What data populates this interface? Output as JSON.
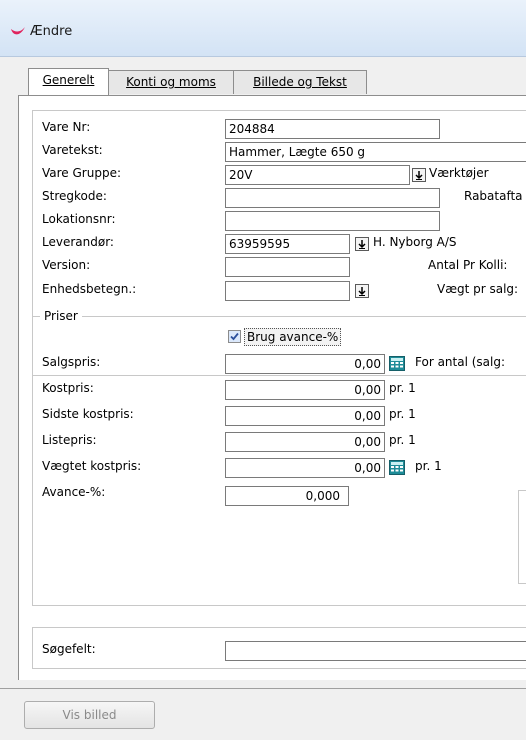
{
  "window": {
    "title": "Ændre"
  },
  "tabs": [
    {
      "label": "Generelt",
      "active": true
    },
    {
      "label": "Konti og moms",
      "active": false
    },
    {
      "label": "Billede og Tekst",
      "active": false
    }
  ],
  "general": {
    "vare_nr": {
      "label": "Vare Nr:",
      "value": "204884"
    },
    "varetekst": {
      "label": "Varetekst:",
      "value": "Hammer, Lægte 650 g"
    },
    "vare_gruppe": {
      "label": "Vare Gruppe:",
      "value": "20V",
      "name": "Værktøjer"
    },
    "stregkode": {
      "label": "Stregkode:",
      "value": "",
      "side_label": "Rabatafta"
    },
    "lokationsnr": {
      "label": "Lokationsnr:",
      "value": ""
    },
    "leverandor": {
      "label": "Leverandør:",
      "value": "63959595",
      "name": "H. Nyborg A/S"
    },
    "version": {
      "label": "Version:",
      "value": "",
      "side_label": "Antal Pr Kolli:"
    },
    "enhedsbetegn": {
      "label": "Enhedsbetegn.:",
      "value": "",
      "side_label": "Vægt pr salg:"
    }
  },
  "priser": {
    "legend": "Priser",
    "brug_avance": {
      "label": "Brug avance-%",
      "checked": true
    },
    "salgspris": {
      "label": "Salgspris:",
      "value": "0,00",
      "side_label": "For antal (salg:"
    },
    "kostpris": {
      "label": "Kostpris:",
      "value": "0,00",
      "per": "pr. 1"
    },
    "sidste_kostpris": {
      "label": "Sidste kostpris:",
      "value": "0,00",
      "per": "pr. 1"
    },
    "listepris": {
      "label": "Listepris:",
      "value": "0,00",
      "per": "pr. 1"
    },
    "vaegtet_kostpris": {
      "label": "Vægtet kostpris:",
      "value": "0,00",
      "per": "pr. 1"
    },
    "avance": {
      "label": "Avance-%:",
      "value": "0,000"
    }
  },
  "sogefelt": {
    "label": "Søgefelt:",
    "value": ""
  },
  "footer": {
    "vis_billed": "Vis billed"
  },
  "icons": {
    "app": "app-logo-icon",
    "dropdown": "dropdown-arrow-icon",
    "calculator": "calculator-icon"
  },
  "colors": {
    "app_icon": "#e0245e",
    "calc_icon": "#1e8c98",
    "checkbox_check": "#2b4f9c"
  }
}
